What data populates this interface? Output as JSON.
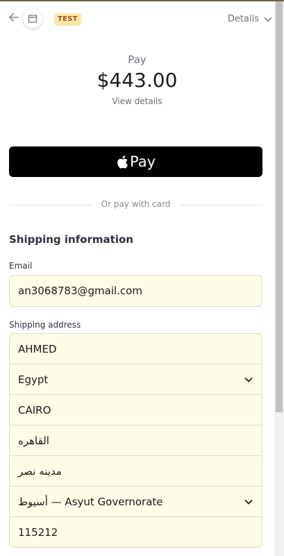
{
  "header": {
    "back_icon": "arrow-left-icon",
    "logo_icon": "store-icon",
    "badge": "TEST",
    "details_label": "Details"
  },
  "summary": {
    "pay_label": "Pay",
    "amount": "$443.00",
    "view_details": "View details"
  },
  "apple_pay": {
    "label": "Pay",
    "icon": "apple-icon"
  },
  "divider_text": "Or pay with card",
  "shipping": {
    "title": "Shipping information",
    "email_label": "Email",
    "email_value": "an3068783@gmail.com",
    "address_label": "Shipping address",
    "name": "AHMED",
    "country": "Egypt",
    "city": "CAIRO",
    "address_line1": "القاهره",
    "address_line2": "مدينه نصر",
    "state": "أسيوط — Asyut Governorate",
    "postal_code": "115212"
  },
  "colors": {
    "field_bg": "#fefbe6",
    "badge_bg": "#fde8a8",
    "badge_text": "#a0521c",
    "apple_pay_bg": "#000000"
  }
}
